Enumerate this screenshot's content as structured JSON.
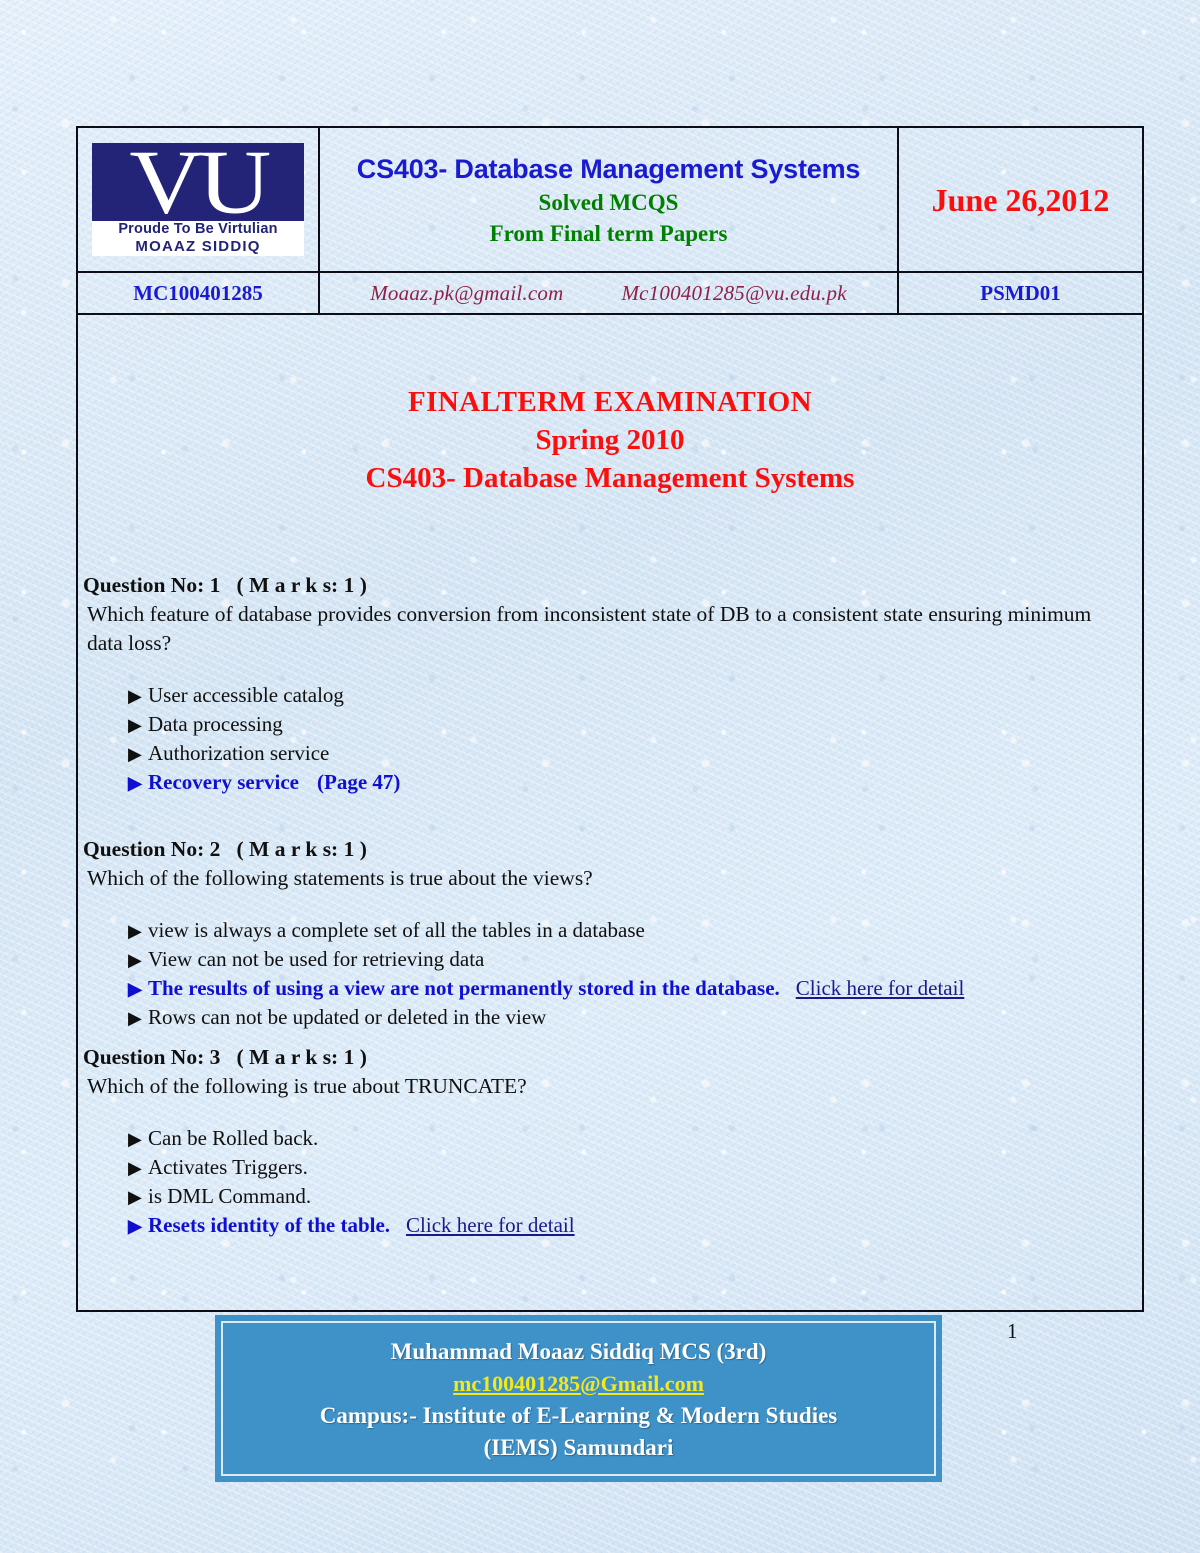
{
  "document": {
    "page_number": "1"
  },
  "header": {
    "logo": {
      "letters": "VU",
      "tagline_1": "Proude To Be Virtulian",
      "tagline_2": "MOAAZ SIDDIQ",
      "box_color": "#232377"
    },
    "title_line_1": "CS403- Database Management Systems",
    "title_line_2": "Solved MCQS",
    "title_line_3": "From Final term Papers",
    "date": "June 26,2012",
    "student_id": "MC100401285",
    "email_1": "Moaaz.pk@gmail.com",
    "email_2": "Mc100401285@vu.edu.pk",
    "paper_code": "PSMD01",
    "colors": {
      "title_blue": "#1a1ad0",
      "subtitle_green": "#008000",
      "date_red": "#fa0f0f",
      "id_blue": "#1a1ad0",
      "email_maroon": "#8e2149"
    }
  },
  "exam_title": {
    "line_1": "FINALTERM  EXAMINATION",
    "line_2": "Spring 2010",
    "line_3": "CS403- Database Management Systems",
    "color": "#fa0f0f"
  },
  "questions": [
    {
      "number": "Question No: 1",
      "marks_label": "M a r k s:",
      "marks_value": "1",
      "text": "Which feature of database provides conversion from inconsistent state of DB to a consistent state ensuring minimum data loss?",
      "options": [
        {
          "label": "User accessible catalog",
          "correct": false,
          "suffix": ""
        },
        {
          "label": "Data processing",
          "correct": false,
          "suffix": ""
        },
        {
          "label": "Authorization service",
          "correct": false,
          "suffix": ""
        },
        {
          "label": "Recovery service",
          "correct": true,
          "suffix": "(Page 47)",
          "suffix_type": "page-ref"
        }
      ]
    },
    {
      "number": "Question No: 2",
      "marks_label": "M a r k s:",
      "marks_value": "1",
      "text": "Which of the following statements is true about the views?",
      "options": [
        {
          "label": "view is always a complete set of all the tables in a database",
          "correct": false,
          "suffix": ""
        },
        {
          "label": "View can not be used for retrieving data",
          "correct": false,
          "suffix": ""
        },
        {
          "label": "The results of using a view are not permanently stored in the database.",
          "correct": true,
          "suffix": "Click here for detail",
          "suffix_type": "link"
        },
        {
          "label": "Rows can not be updated or deleted in the view",
          "correct": false,
          "suffix": ""
        }
      ]
    },
    {
      "number": "Question No: 3",
      "marks_label": "M a r k s:",
      "marks_value": "1",
      "text": "Which of the following is true about TRUNCATE?",
      "options": [
        {
          "label": "Can be Rolled back.",
          "correct": false,
          "suffix": ""
        },
        {
          "label": "Activates Triggers.",
          "correct": false,
          "suffix": ""
        },
        {
          "label": "is DML Command.",
          "correct": false,
          "suffix": ""
        },
        {
          "label": "Resets identity of the table.",
          "correct": true,
          "suffix": "Click here for detail",
          "suffix_type": "link"
        }
      ]
    }
  ],
  "footer": {
    "name": "Muhammad Moaaz  Siddiq MCS (3rd)",
    "email": "mc100401285@Gmail.com",
    "campus_line_1": "Campus:- Institute of E-Learning & Modern Studies",
    "campus_line_2": "(IEMS) Samundari",
    "background_color": "#3f92c8",
    "email_color": "#f2e81e"
  }
}
